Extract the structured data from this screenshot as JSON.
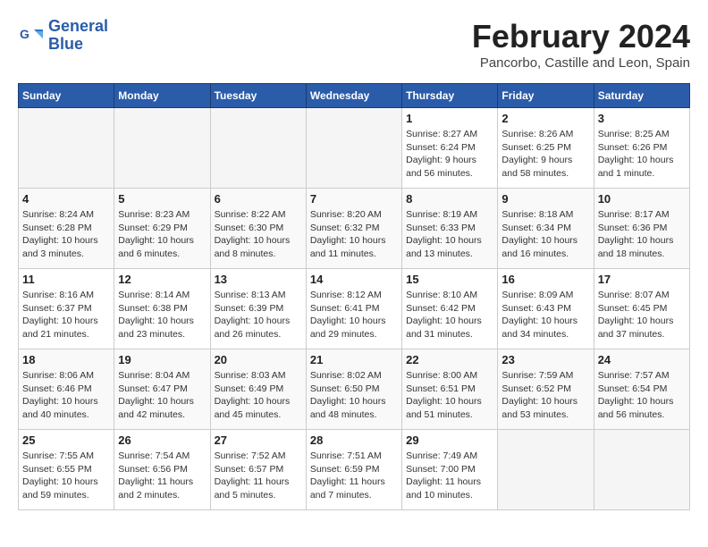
{
  "header": {
    "logo_line1": "General",
    "logo_line2": "Blue",
    "month_year": "February 2024",
    "location": "Pancorbo, Castille and Leon, Spain"
  },
  "weekdays": [
    "Sunday",
    "Monday",
    "Tuesday",
    "Wednesday",
    "Thursday",
    "Friday",
    "Saturday"
  ],
  "weeks": [
    [
      {
        "day": "",
        "info": ""
      },
      {
        "day": "",
        "info": ""
      },
      {
        "day": "",
        "info": ""
      },
      {
        "day": "",
        "info": ""
      },
      {
        "day": "1",
        "info": "Sunrise: 8:27 AM\nSunset: 6:24 PM\nDaylight: 9 hours\nand 56 minutes."
      },
      {
        "day": "2",
        "info": "Sunrise: 8:26 AM\nSunset: 6:25 PM\nDaylight: 9 hours\nand 58 minutes."
      },
      {
        "day": "3",
        "info": "Sunrise: 8:25 AM\nSunset: 6:26 PM\nDaylight: 10 hours\nand 1 minute."
      }
    ],
    [
      {
        "day": "4",
        "info": "Sunrise: 8:24 AM\nSunset: 6:28 PM\nDaylight: 10 hours\nand 3 minutes."
      },
      {
        "day": "5",
        "info": "Sunrise: 8:23 AM\nSunset: 6:29 PM\nDaylight: 10 hours\nand 6 minutes."
      },
      {
        "day": "6",
        "info": "Sunrise: 8:22 AM\nSunset: 6:30 PM\nDaylight: 10 hours\nand 8 minutes."
      },
      {
        "day": "7",
        "info": "Sunrise: 8:20 AM\nSunset: 6:32 PM\nDaylight: 10 hours\nand 11 minutes."
      },
      {
        "day": "8",
        "info": "Sunrise: 8:19 AM\nSunset: 6:33 PM\nDaylight: 10 hours\nand 13 minutes."
      },
      {
        "day": "9",
        "info": "Sunrise: 8:18 AM\nSunset: 6:34 PM\nDaylight: 10 hours\nand 16 minutes."
      },
      {
        "day": "10",
        "info": "Sunrise: 8:17 AM\nSunset: 6:36 PM\nDaylight: 10 hours\nand 18 minutes."
      }
    ],
    [
      {
        "day": "11",
        "info": "Sunrise: 8:16 AM\nSunset: 6:37 PM\nDaylight: 10 hours\nand 21 minutes."
      },
      {
        "day": "12",
        "info": "Sunrise: 8:14 AM\nSunset: 6:38 PM\nDaylight: 10 hours\nand 23 minutes."
      },
      {
        "day": "13",
        "info": "Sunrise: 8:13 AM\nSunset: 6:39 PM\nDaylight: 10 hours\nand 26 minutes."
      },
      {
        "day": "14",
        "info": "Sunrise: 8:12 AM\nSunset: 6:41 PM\nDaylight: 10 hours\nand 29 minutes."
      },
      {
        "day": "15",
        "info": "Sunrise: 8:10 AM\nSunset: 6:42 PM\nDaylight: 10 hours\nand 31 minutes."
      },
      {
        "day": "16",
        "info": "Sunrise: 8:09 AM\nSunset: 6:43 PM\nDaylight: 10 hours\nand 34 minutes."
      },
      {
        "day": "17",
        "info": "Sunrise: 8:07 AM\nSunset: 6:45 PM\nDaylight: 10 hours\nand 37 minutes."
      }
    ],
    [
      {
        "day": "18",
        "info": "Sunrise: 8:06 AM\nSunset: 6:46 PM\nDaylight: 10 hours\nand 40 minutes."
      },
      {
        "day": "19",
        "info": "Sunrise: 8:04 AM\nSunset: 6:47 PM\nDaylight: 10 hours\nand 42 minutes."
      },
      {
        "day": "20",
        "info": "Sunrise: 8:03 AM\nSunset: 6:49 PM\nDaylight: 10 hours\nand 45 minutes."
      },
      {
        "day": "21",
        "info": "Sunrise: 8:02 AM\nSunset: 6:50 PM\nDaylight: 10 hours\nand 48 minutes."
      },
      {
        "day": "22",
        "info": "Sunrise: 8:00 AM\nSunset: 6:51 PM\nDaylight: 10 hours\nand 51 minutes."
      },
      {
        "day": "23",
        "info": "Sunrise: 7:59 AM\nSunset: 6:52 PM\nDaylight: 10 hours\nand 53 minutes."
      },
      {
        "day": "24",
        "info": "Sunrise: 7:57 AM\nSunset: 6:54 PM\nDaylight: 10 hours\nand 56 minutes."
      }
    ],
    [
      {
        "day": "25",
        "info": "Sunrise: 7:55 AM\nSunset: 6:55 PM\nDaylight: 10 hours\nand 59 minutes."
      },
      {
        "day": "26",
        "info": "Sunrise: 7:54 AM\nSunset: 6:56 PM\nDaylight: 11 hours\nand 2 minutes."
      },
      {
        "day": "27",
        "info": "Sunrise: 7:52 AM\nSunset: 6:57 PM\nDaylight: 11 hours\nand 5 minutes."
      },
      {
        "day": "28",
        "info": "Sunrise: 7:51 AM\nSunset: 6:59 PM\nDaylight: 11 hours\nand 7 minutes."
      },
      {
        "day": "29",
        "info": "Sunrise: 7:49 AM\nSunset: 7:00 PM\nDaylight: 11 hours\nand 10 minutes."
      },
      {
        "day": "",
        "info": ""
      },
      {
        "day": "",
        "info": ""
      }
    ]
  ]
}
